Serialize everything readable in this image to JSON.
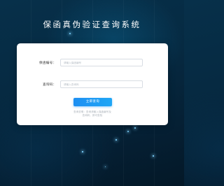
{
  "header": {
    "title": "保函真伪验证查询系统"
  },
  "form": {
    "guarantee_no_label": "保函编号：",
    "guarantee_no_placeholder": "请输入保函编号",
    "query_code_label": "查询码：",
    "query_code_placeholder": "请输入查询码",
    "submit_label": "立即查询",
    "tip_line1": "查询说明：查询请输入保函编号及",
    "tip_line2": "查询码，即可查验"
  },
  "colors": {
    "background": "#062a42",
    "accent": "#1d8ff2",
    "card": "#ffffff"
  }
}
